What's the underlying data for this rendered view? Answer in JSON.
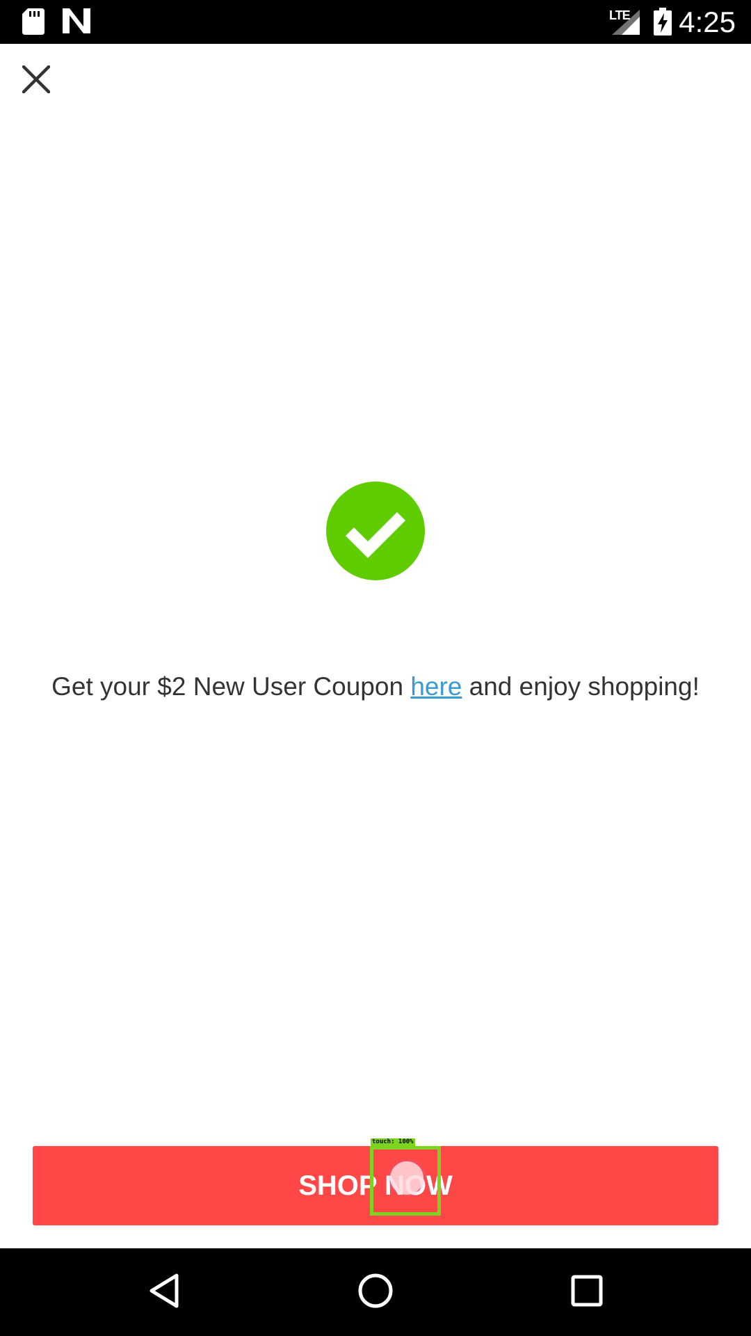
{
  "status_bar": {
    "time": "4:25",
    "network_label": "LTE",
    "icons": [
      "sd-card-icon",
      "n-notification-icon",
      "signal-icon",
      "battery-charging-icon"
    ]
  },
  "close": {
    "icon": "close-icon"
  },
  "success": {
    "icon": "check-circle-icon",
    "color": "#5fcc00"
  },
  "message": {
    "before": "Get your $2 New User Coupon ",
    "link": "here",
    "after": " and enjoy shopping!",
    "link_color": "#3a9bd4"
  },
  "cta": {
    "label": "SHOP NOW",
    "color": "#ff4747"
  },
  "touch_overlay": {
    "label": "touch: 100%"
  },
  "nav_bar": {
    "icons": [
      "back-icon",
      "home-icon",
      "recents-icon"
    ]
  }
}
